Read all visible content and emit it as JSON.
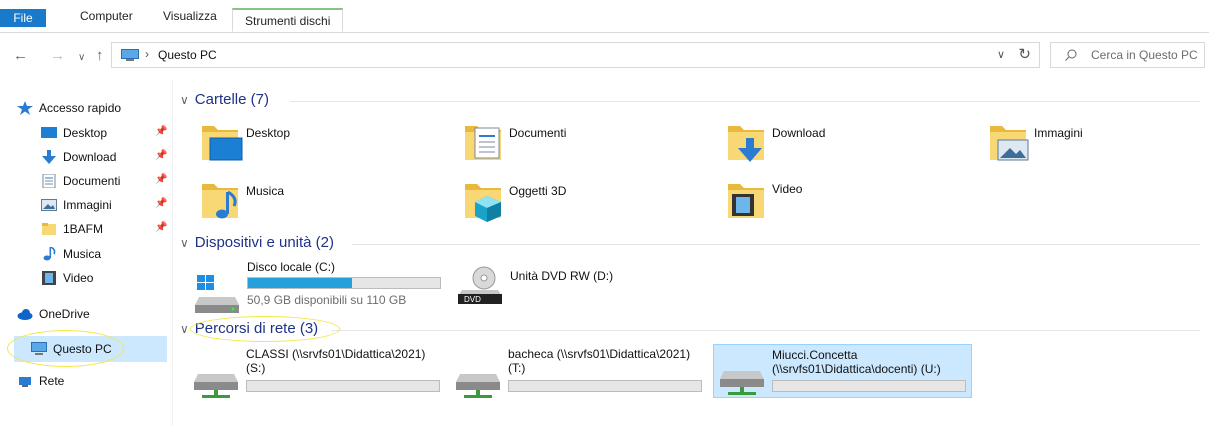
{
  "ribbon": {
    "tabs": [
      {
        "label": "File"
      },
      {
        "label": "Computer"
      },
      {
        "label": "Visualizza"
      },
      {
        "label": "Strumenti dischi"
      }
    ]
  },
  "navbar": {
    "location": "Questo PC",
    "search_placeholder": "Cerca in Questo PC",
    "icons": [
      "back-arrow-icon",
      "forward-arrow-icon",
      "recent-dropdown-icon",
      "up-arrow-icon",
      "refresh-icon",
      "search-icon"
    ]
  },
  "sidebar": {
    "items": [
      {
        "label": "Accesso rapido",
        "icon": "star-icon"
      },
      {
        "label": "Desktop",
        "icon": "desktop-icon",
        "pinned": true
      },
      {
        "label": "Download",
        "icon": "download-icon",
        "pinned": true
      },
      {
        "label": "Documenti",
        "icon": "documents-icon",
        "pinned": true
      },
      {
        "label": "Immagini",
        "icon": "pictures-icon",
        "pinned": true
      },
      {
        "label": "1BAFM",
        "icon": "folder-icon",
        "pinned": true
      },
      {
        "label": "Musica",
        "icon": "music-icon"
      },
      {
        "label": "Video",
        "icon": "video-icon"
      },
      {
        "label": "OneDrive",
        "icon": "cloud-icon"
      },
      {
        "label": "Questo PC",
        "icon": "pc-icon",
        "selected": true
      },
      {
        "label": "Rete",
        "icon": "network-icon"
      }
    ]
  },
  "sections": {
    "folders_title": "Cartelle (7)",
    "devices_title": "Dispositivi e unità (2)",
    "network_title": "Percorsi di rete (3)"
  },
  "folders": [
    {
      "label": "Desktop"
    },
    {
      "label": "Documenti"
    },
    {
      "label": "Download"
    },
    {
      "label": "Immagini"
    },
    {
      "label": "Musica"
    },
    {
      "label": "Oggetti 3D"
    },
    {
      "label": "Video"
    }
  ],
  "devices": [
    {
      "name": "Disco locale (C:)",
      "info": "50,9 GB disponibili su 110 GB",
      "used_fraction": 0.54
    },
    {
      "name": "Unità DVD RW (D:)",
      "badge": "DVD"
    }
  ],
  "network_locations": [
    {
      "line1": "CLASSI (\\\\srvfs01\\Didattica\\2021)",
      "line2": "(S:)"
    },
    {
      "line1": "bacheca (\\\\srvfs01\\Didattica\\2021)",
      "line2": "(T:)"
    },
    {
      "line1": "Miucci.Concetta",
      "line2": "(\\\\srvfs01\\Didattica\\docenti) (U:)",
      "selected": true
    }
  ],
  "colors": {
    "accent": "#1979ca",
    "selection": "#cce8ff",
    "section_title": "#1e3287",
    "progress": "#26a0da",
    "annotation": "#f1e84a"
  }
}
